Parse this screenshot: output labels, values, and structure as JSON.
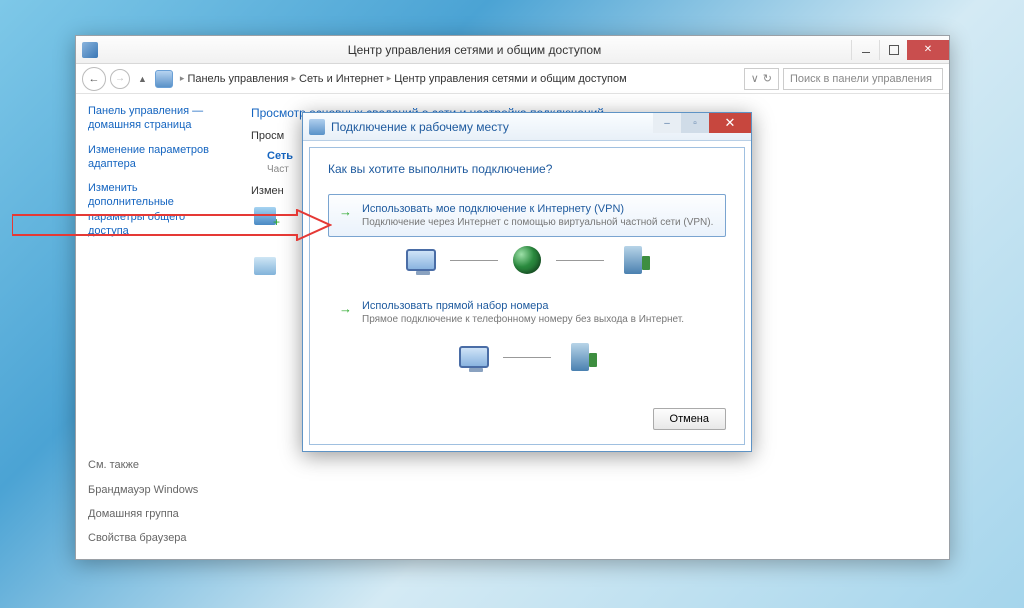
{
  "window": {
    "title": "Центр управления сетями и общим доступом"
  },
  "breadcrumb": {
    "root": "Панель управления",
    "lvl2": "Сеть и Интернет",
    "lvl3": "Центр управления сетями и общим доступом"
  },
  "search": {
    "placeholder": "Поиск в панели управления"
  },
  "sidebar": {
    "home": "Панель управления — домашняя страница",
    "adapter": "Изменение параметров адаптера",
    "sharing": "Изменить дополнительные параметры общего доступа",
    "seealso_title": "См. также",
    "firewall": "Брандмауэр Windows",
    "homegroup": "Домашняя группа",
    "browser": "Свойства браузера"
  },
  "main": {
    "heading": "Просмотр основных сведений о сети и настройка подключений",
    "view_active": "Просм",
    "network_label": "Сеть",
    "network_sub": "Част",
    "change_label": "Измен"
  },
  "dialog": {
    "title": "Подключение к рабочему месту",
    "question": "Как вы хотите выполнить подключение?",
    "opt1_title": "Использовать мое подключение к Интернету (VPN)",
    "opt1_desc": "Подключение через Интернет с помощью виртуальной частной сети (VPN).",
    "opt2_title": "Использовать прямой набор номера",
    "opt2_desc": "Прямое подключение к телефонному номеру без выхода в Интернет.",
    "cancel": "Отмена"
  }
}
